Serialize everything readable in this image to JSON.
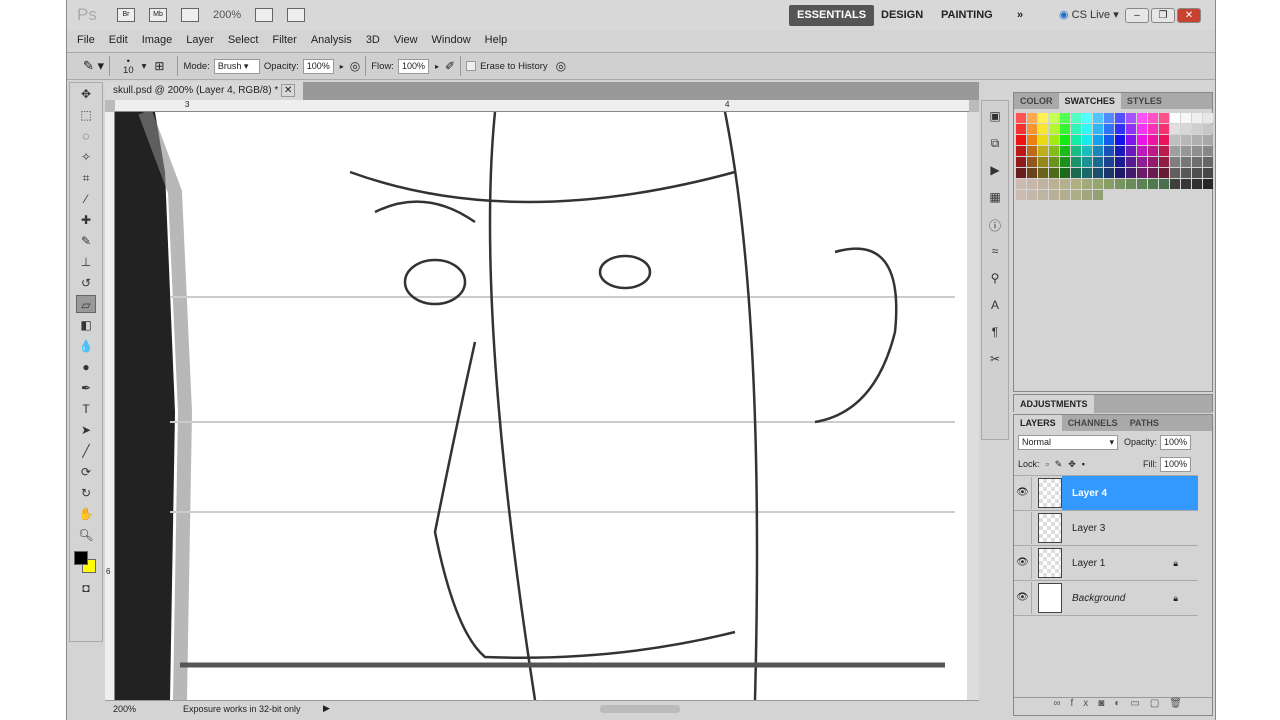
{
  "app": {
    "logo": "Ps",
    "bridge": "Br",
    "minibridge": "Mb",
    "zoom": "200%"
  },
  "workspaces": [
    "ESSENTIALS",
    "DESIGN",
    "PAINTING",
    "»"
  ],
  "cslive": "CS Live",
  "menu": [
    "File",
    "Edit",
    "Image",
    "Layer",
    "Select",
    "Filter",
    "Analysis",
    "3D",
    "View",
    "Window",
    "Help"
  ],
  "options": {
    "brush_size": "10",
    "mode_label": "Mode:",
    "mode_value": "Brush",
    "opacity_label": "Opacity:",
    "opacity_value": "100%",
    "flow_label": "Flow:",
    "flow_value": "100%",
    "erase_history": "Erase to History"
  },
  "document": {
    "tab": "skull.psd @ 200% (Layer 4, RGB/8) *",
    "ruler_h": [
      "3",
      "4"
    ],
    "ruler_v": [
      "6"
    ]
  },
  "status": {
    "zoom": "200%",
    "info": "Exposure works in 32-bit only"
  },
  "color_panel": {
    "tabs": [
      "COLOR",
      "SWATCHES",
      "STYLES"
    ]
  },
  "adjustments": {
    "title": "ADJUSTMENTS"
  },
  "layers_panel": {
    "tabs": [
      "LAYERS",
      "CHANNELS",
      "PATHS"
    ],
    "blend": "Normal",
    "opacity_label": "Opacity:",
    "opacity": "100%",
    "lock_label": "Lock:",
    "fill_label": "Fill:",
    "fill": "100%",
    "layers": [
      {
        "name": "Layer 4",
        "visible": true,
        "selected": true,
        "locked": false
      },
      {
        "name": "Layer 3",
        "visible": false,
        "selected": false,
        "locked": false
      },
      {
        "name": "Layer 1",
        "visible": true,
        "selected": false,
        "locked": true
      },
      {
        "name": "Background",
        "visible": true,
        "selected": false,
        "locked": true
      }
    ]
  },
  "colors": {
    "selection": "#3399ff",
    "foreground": "#000000",
    "background": "#ffff00"
  }
}
